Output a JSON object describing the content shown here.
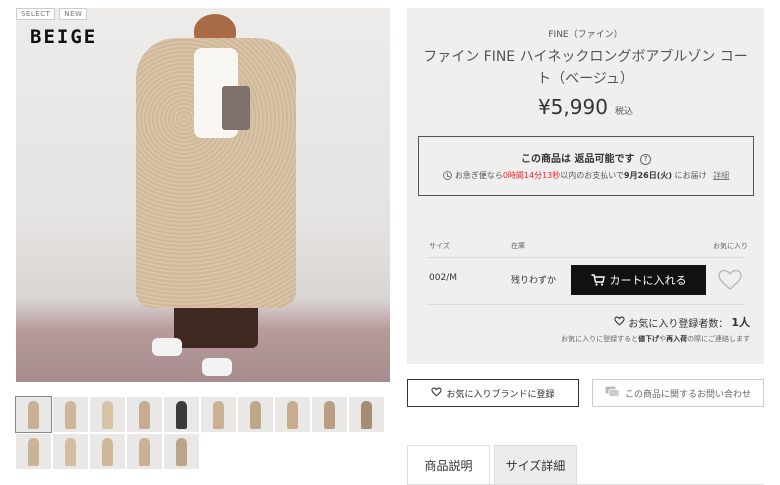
{
  "gallery": {
    "tags": [
      "SELECT",
      "NEW"
    ],
    "color_label": "BEIGE",
    "thumbnails": [
      {
        "fig": "#c7b093"
      },
      {
        "fig": "#cdb79b"
      },
      {
        "fig": "#d7c2a6"
      },
      {
        "fig": "#c4ad90"
      },
      {
        "fig": "#3b3b3b"
      },
      {
        "fig": "#c9b294"
      },
      {
        "fig": "#bda78a"
      },
      {
        "fig": "#c6ad8d"
      },
      {
        "fig": "#b99f80"
      },
      {
        "fig": "#a58d74"
      },
      {
        "fig": "#cab498"
      },
      {
        "fig": "#d4bea3"
      },
      {
        "fig": "#cfb898"
      },
      {
        "fig": "#c9b193"
      },
      {
        "fig": "#bba488"
      }
    ]
  },
  "product": {
    "brand": "FINE（ファイン）",
    "title": "ファイン FINE ハイネックロングボアブルゾン コート（ベージュ）",
    "price": "¥5,990",
    "tax_label": "税込"
  },
  "returns": {
    "title": "この商品は 返品可能です",
    "help": "?",
    "delivery_prefix": "お急ぎ便なら",
    "delivery_time": "0時間14分13秒",
    "delivery_mid": "以内のお支払いで",
    "delivery_date": "9月26日(火)",
    "delivery_suffix": "にお届け",
    "details_link": "詳細"
  },
  "variants": {
    "headers": {
      "size": "サイズ",
      "stock": "在庫",
      "favorite": "お気に入り"
    },
    "rows": [
      {
        "size": "002/M",
        "stock": "残りわずか",
        "cart_label": "カートに入れる"
      }
    ],
    "fav_count_label": "お気に入り登録者数：",
    "fav_count": "1人",
    "fav_note_prefix": "お気に入りに登録すると",
    "fav_note_b1": "値下げ",
    "fav_note_mid": "や",
    "fav_note_b2": "再入荷",
    "fav_note_suffix": "の際にご連絡します"
  },
  "actions": {
    "fav_brand": "お気に入りブランドに登録",
    "inquiry": "この商品に関するお問い合わせ"
  },
  "tabs": [
    {
      "label": "商品説明"
    },
    {
      "label": "サイズ詳細"
    }
  ]
}
